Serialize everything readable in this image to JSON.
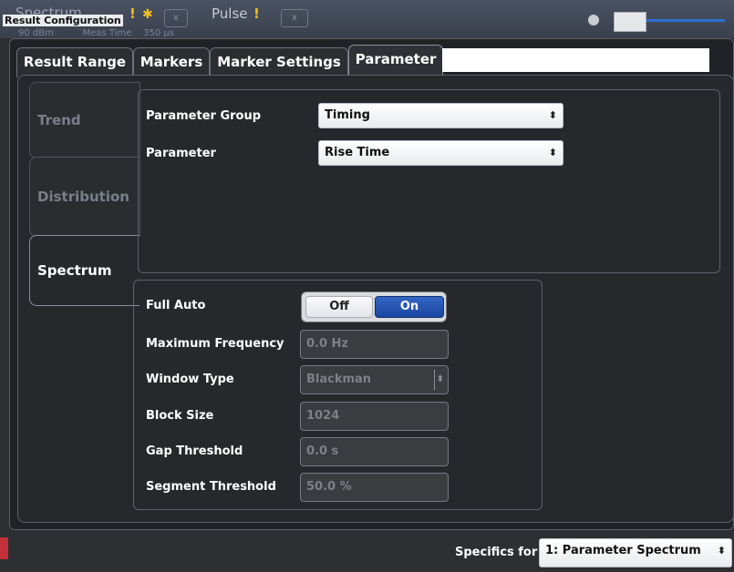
{
  "header": {
    "app_title": "Spectrum",
    "dialog_title": "Result Configuration",
    "tab2_title": "Pulse",
    "tab_close": "x",
    "warning_glyph": "!",
    "star_glyph": "✱",
    "sub_info": "90 dBm          Meas Time    350 µs"
  },
  "tabs": [
    {
      "label": "Result Range"
    },
    {
      "label": "Markers"
    },
    {
      "label": "Marker Settings"
    },
    {
      "label": "Parameter"
    }
  ],
  "side_tabs": [
    {
      "label": "Trend"
    },
    {
      "label": "Distribution"
    },
    {
      "label": "Spectrum"
    }
  ],
  "parameter": {
    "group_label": "Parameter Group",
    "group_value": "Timing",
    "param_label": "Parameter",
    "param_value": "Rise Time",
    "select_arrow": "⬍"
  },
  "spectrum": {
    "full_auto_label": "Full Auto",
    "off_label": "Off",
    "on_label": "On",
    "max_freq_label": "Maximum Frequency",
    "max_freq_value": "0.0 Hz",
    "window_type_label": "Window Type",
    "window_type_value": "Blackman",
    "block_size_label": "Block Size",
    "block_size_value": "1024",
    "gap_threshold_label": "Gap Threshold",
    "gap_threshold_value": "0.0 s",
    "segment_threshold_label": "Segment Threshold",
    "segment_threshold_value": "50.0 %"
  },
  "footer": {
    "specifics_label": "Specifics for",
    "specifics_value": "1: Parameter Spectrum"
  },
  "colors": {
    "accent_on": "#1f4fb0",
    "background": "#26282c"
  }
}
